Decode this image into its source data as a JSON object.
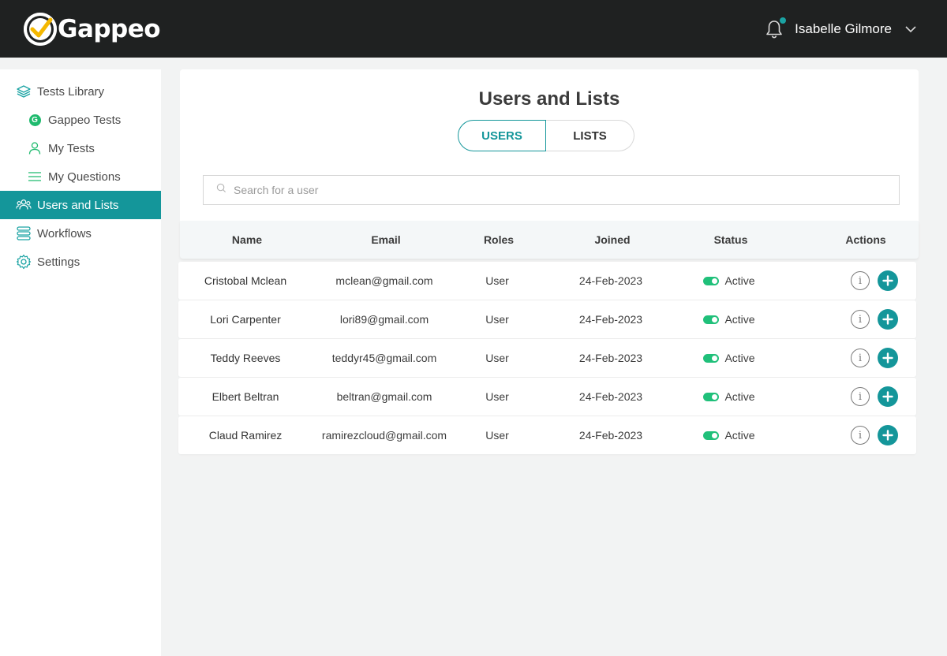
{
  "app": {
    "brand": "Gappeo"
  },
  "header": {
    "user_name": "Isabelle Gilmore"
  },
  "sidebar": {
    "items": [
      {
        "label": "Tests Library",
        "icon": "layers-icon",
        "level": 1,
        "active": false
      },
      {
        "label": "Gappeo Tests",
        "icon": "g-badge-icon",
        "level": 2,
        "active": false
      },
      {
        "label": "My Tests",
        "icon": "person-icon",
        "level": 2,
        "active": false
      },
      {
        "label": "My Questions",
        "icon": "lines-icon",
        "level": 2,
        "active": false
      },
      {
        "label": "Users and Lists",
        "icon": "users-icon",
        "level": 1,
        "active": true
      },
      {
        "label": "Workflows",
        "icon": "workflow-icon",
        "level": 1,
        "active": false
      },
      {
        "label": "Settings",
        "icon": "gear-icon",
        "level": 1,
        "active": false
      }
    ],
    "g_badge_letter": "G"
  },
  "main": {
    "title": "Users and Lists",
    "tabs": [
      {
        "label": "USERS",
        "active": true
      },
      {
        "label": "LISTS",
        "active": false
      }
    ],
    "search": {
      "placeholder": "Search for a user",
      "value": ""
    },
    "table": {
      "headers": [
        "Name",
        "Email",
        "Roles",
        "Joined",
        "Status",
        "Actions"
      ],
      "rows": [
        {
          "name": "Cristobal Mclean",
          "email": "mclean@gmail.com",
          "role": "User",
          "joined": "24-Feb-2023",
          "status": "Active"
        },
        {
          "name": "Lori Carpenter",
          "email": "lori89@gmail.com",
          "role": "User",
          "joined": "24-Feb-2023",
          "status": "Active"
        },
        {
          "name": "Teddy Reeves",
          "email": "teddyr45@gmail.com",
          "role": "User",
          "joined": "24-Feb-2023",
          "status": "Active"
        },
        {
          "name": "Elbert Beltran",
          "email": "beltran@gmail.com",
          "role": "User",
          "joined": "24-Feb-2023",
          "status": "Active"
        },
        {
          "name": "Claud Ramirez",
          "email": "ramirezcloud@gmail.com",
          "role": "User",
          "joined": "24-Feb-2023",
          "status": "Active"
        }
      ],
      "info_glyph": "i"
    }
  },
  "colors": {
    "accent": "#14969a",
    "topbar": "#1f2121",
    "status_active": "#20c07a",
    "logo_yellow": "#f5b800"
  }
}
